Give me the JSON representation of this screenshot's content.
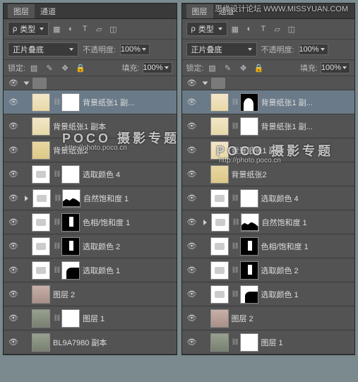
{
  "tabs": {
    "layers": "图层",
    "channels": "通道"
  },
  "typeDrop": "类型",
  "blend": {
    "mode": "正片叠底",
    "opacityLabel": "不透明度:",
    "opacity": "100%",
    "fillLabel": "填充:",
    "fill": "100%",
    "lockLabel": "锁定:"
  },
  "leftLayers": [
    {
      "name": "背景纸张1 副...",
      "t1": "parch",
      "t2": "white",
      "sel": true
    },
    {
      "name": "背景纸张1 副本",
      "t1": "parch"
    },
    {
      "name": "背景纸张2",
      "t1": "parch2"
    },
    {
      "name": "选取颜色 4",
      "t1": "adj",
      "t2": "white"
    },
    {
      "name": "自然饱和度 1",
      "t1": "adj",
      "t2": "silh",
      "tri": true
    },
    {
      "name": "色相/饱和度 1",
      "t1": "adj",
      "t2": "silh2"
    },
    {
      "name": "选取颜色 2",
      "t1": "adj",
      "t2": "silh2"
    },
    {
      "name": "选取颜色 1",
      "t1": "adj",
      "t2": "silh3"
    },
    {
      "name": "图层 2",
      "t1": "photo"
    },
    {
      "name": "图层 1",
      "t1": "photo2",
      "t2": "white"
    },
    {
      "name": "BL9A7980 副本",
      "t1": "photo2"
    }
  ],
  "rightLayers": [
    {
      "name": "背景纸张1 副...",
      "t1": "parch",
      "t2": "silh4",
      "sel": true
    },
    {
      "name": "背景纸张1 副...",
      "t1": "parch",
      "t2": "white"
    },
    {
      "name": "背景纸张1 副本",
      "t1": "parch"
    },
    {
      "name": "背景纸张2",
      "t1": "parch2"
    },
    {
      "name": "选取颜色 4",
      "t1": "adj",
      "t2": "white"
    },
    {
      "name": "自然饱和度 1",
      "t1": "adj",
      "t2": "silh",
      "tri": true
    },
    {
      "name": "色相/饱和度 1",
      "t1": "adj",
      "t2": "silh2"
    },
    {
      "name": "选取颜色 2",
      "t1": "adj",
      "t2": "silh2"
    },
    {
      "name": "选取颜色 1",
      "t1": "adj",
      "t2": "silh3"
    },
    {
      "name": "图层 2",
      "t1": "photo"
    },
    {
      "name": "图层 1",
      "t1": "photo2",
      "t2": "white"
    }
  ],
  "watermark": {
    "site": "思缘设计论坛 WWW.MISSYUAN.COM",
    "brand": "POCO 摄影专题",
    "url": "http://photo.poco.cn"
  }
}
